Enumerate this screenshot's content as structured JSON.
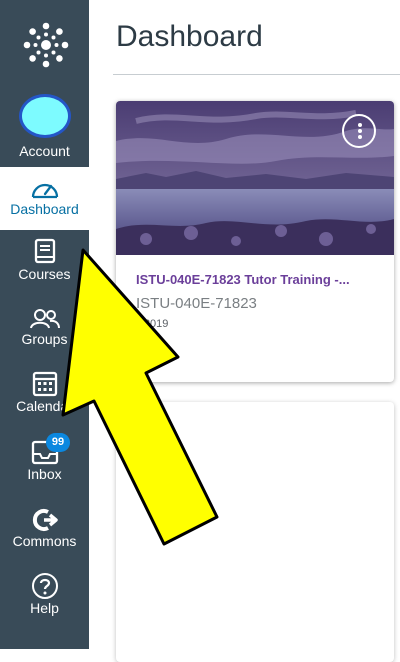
{
  "header": {
    "title": "Dashboard"
  },
  "nav": {
    "account": "Account",
    "dashboard": "Dashboard",
    "courses": "Courses",
    "groups": "Groups",
    "calendar": "Calendar",
    "inbox": "Inbox",
    "inbox_badge": "99",
    "commons": "Commons",
    "help": "Help"
  },
  "course_card": {
    "title": "ISTU-040E-71823 Tutor Training -...",
    "code": "ISTU-040E-71823",
    "term": "ll 2019"
  },
  "colors": {
    "sidebar": "#394b58",
    "active_nav": "#0770a3",
    "course_title": "#6b3f9a",
    "annotation_arrow": "#ffff00"
  }
}
